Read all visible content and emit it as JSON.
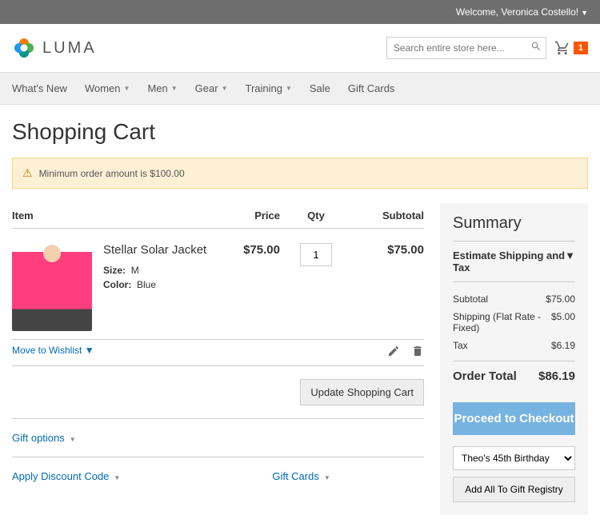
{
  "topbar": {
    "welcome": "Welcome, Veronica Costello!"
  },
  "logo": {
    "text": "LUMA"
  },
  "search": {
    "placeholder": "Search entire store here..."
  },
  "cart": {
    "count": "1"
  },
  "nav": {
    "items": [
      {
        "label": "What's New",
        "dropdown": false
      },
      {
        "label": "Women",
        "dropdown": true
      },
      {
        "label": "Men",
        "dropdown": true
      },
      {
        "label": "Gear",
        "dropdown": true
      },
      {
        "label": "Training",
        "dropdown": true
      },
      {
        "label": "Sale",
        "dropdown": false
      },
      {
        "label": "Gift Cards",
        "dropdown": false
      }
    ]
  },
  "page": {
    "title": "Shopping Cart"
  },
  "alert": {
    "text": "Minimum order amount is $100.00"
  },
  "cart_table": {
    "headers": {
      "item": "Item",
      "price": "Price",
      "qty": "Qty",
      "subtotal": "Subtotal"
    },
    "item": {
      "name": "Stellar Solar Jacket",
      "size_label": "Size:",
      "size_value": "M",
      "color_label": "Color:",
      "color_value": "Blue",
      "price": "$75.00",
      "qty": "1",
      "subtotal": "$75.00"
    },
    "wishlist": "Move to Wishlist",
    "update_btn": "Update Shopping Cart",
    "gift_options": "Gift options",
    "discount": "Apply Discount Code",
    "giftcards": "Gift Cards"
  },
  "summary": {
    "title": "Summary",
    "estimate": "Estimate Shipping and Tax",
    "lines": {
      "subtotal_label": "Subtotal",
      "subtotal_value": "$75.00",
      "shipping_label": "Shipping (Flat Rate - Fixed)",
      "shipping_value": "$5.00",
      "tax_label": "Tax",
      "tax_value": "$6.19"
    },
    "total_label": "Order Total",
    "total_value": "$86.19",
    "checkout": "Proceed to Checkout",
    "registry_option": "Theo's 45th Birthday",
    "registry_btn": "Add All To Gift Registry"
  }
}
